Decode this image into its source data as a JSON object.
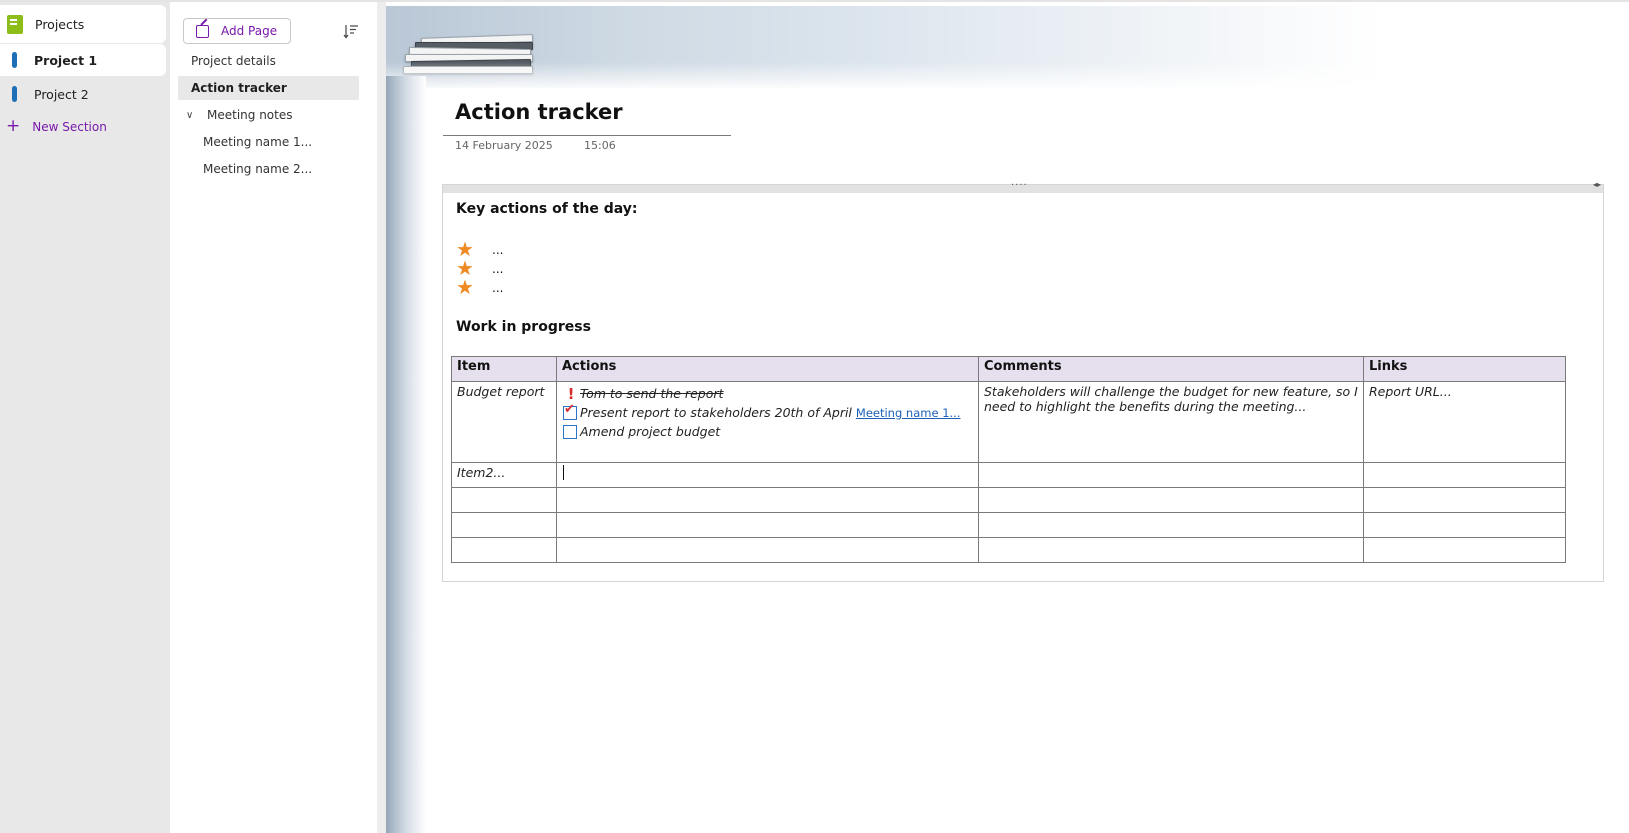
{
  "notebook": {
    "title": "Projects"
  },
  "sections": [
    {
      "label": "Project 1",
      "selected": true
    },
    {
      "label": "Project 2",
      "selected": false
    }
  ],
  "new_section_label": "New Section",
  "page_pane": {
    "add_page_label": "Add Page",
    "pages": [
      {
        "label": "Project details"
      },
      {
        "label": "Action tracker"
      },
      {
        "label": "Meeting notes"
      },
      {
        "label": "Meeting name 1..."
      },
      {
        "label": "Meeting name 2..."
      }
    ]
  },
  "page": {
    "title": "Action tracker",
    "date": "14 February 2025",
    "time": "15:06",
    "key_heading": "Key actions of the day:",
    "key_items": [
      "...",
      "...",
      "..."
    ],
    "wip_heading": "Work in progress",
    "table": {
      "headers": [
        "Item",
        "Actions",
        "Comments",
        "Links"
      ],
      "row1": {
        "item": "Budget report",
        "actions": [
          "Tom to send the report",
          "Present report to stakeholders 20th of April",
          "Amend project budget"
        ],
        "link_text": "Meeting name 1...",
        "comments": "Stakeholders will challenge the budget for new feature, so I need to highlight the benefits during the meeting...",
        "links": "Report URL..."
      },
      "row2": {
        "item": "Item2..."
      }
    }
  },
  "colors": {
    "accent_purple": "#7719aa",
    "section_tab_blue": "#1e6fb5",
    "notebook_green": "#8cbd18",
    "star_orange": "#f08a24",
    "table_header_bg": "#e6e0ee",
    "exclamation_red": "#d82c2c",
    "link_blue": "#1d5fb8"
  },
  "icons": [
    "notebook-icon",
    "section-tab-icon",
    "plus-icon",
    "add-page-icon",
    "sort-icon",
    "chevron-down-icon",
    "star-icon",
    "exclamation-icon",
    "checkbox-icon"
  ]
}
